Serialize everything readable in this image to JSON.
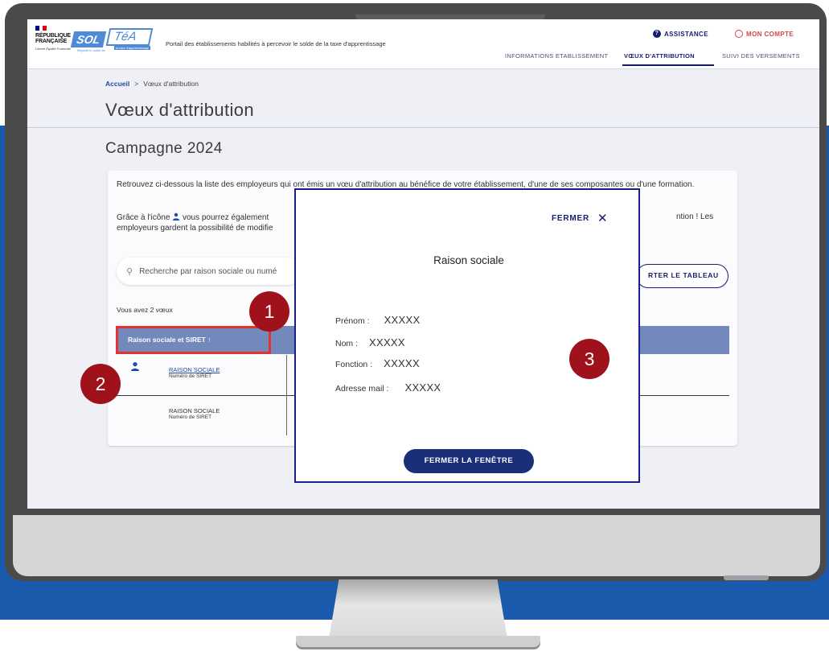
{
  "header": {
    "gov_name": "RÉPUBLIQUE FRANÇAISE",
    "gov_motto": "Liberté Égalité Fraternité",
    "logo_sol": "SOL",
    "logo_tea": "TéA",
    "logo_sol_sub": "Répartir le solde de",
    "logo_tea_sub": "la taxe d'apprentissage",
    "portal_text": "Portail des établissements habilités à percevoir le solde de la taxe d'apprentissage",
    "assistance_label": "ASSISTANCE",
    "account_label": "MON COMPTE",
    "nav": [
      "INFORMATIONS ETABLISSEMENT",
      "VŒUX D'ATTRIBUTION",
      "SUIVI DES VERSEMENTS"
    ]
  },
  "breadcrumb": {
    "home": "Accueil",
    "separator": ">",
    "current": "Vœux d'attribution"
  },
  "page_title": "Vœux d'attribution",
  "campaign_title": "Campagne 2024",
  "card": {
    "intro_1": "Retrouvez ci-dessous la liste des employeurs qui ont émis un vœu d'attribution au bénéfice de votre établissement, d'une de ses composantes ou d'une formation.",
    "intro_2_start": "Grâce à l'icône",
    "intro_2_rest": "vous pourrez également",
    "intro_2_line2": "employeurs gardent la possibilité de modifie",
    "intro_2_end": "ntion ! Les",
    "search_placeholder": "Recherche par raison sociale ou numé",
    "export_label": "RTER LE TABLEAU",
    "count_text": "Vous avez 2 vœux",
    "column_header": "Raison sociale et SIRET ↑",
    "rows": [
      {
        "name": "RAISON SOCIALE",
        "siret": "Numéro de SIRET"
      },
      {
        "name": "RAISON SOCIALE",
        "siret": "Numéro de SIRET"
      }
    ]
  },
  "modal": {
    "close_label": "FERMER",
    "close_icon": "✕",
    "title": "Raison sociale",
    "fields": [
      {
        "label": "Prénom :",
        "value": "XXXXX"
      },
      {
        "label": "Nom :",
        "value": "XXXXX"
      },
      {
        "label": "Fonction :",
        "value": "XXXXX"
      },
      {
        "label": "Adresse mail :",
        "value": "XXXXX"
      }
    ],
    "close_button": "FERMER LA FENÊTRE"
  },
  "callouts": [
    "1",
    "2",
    "3"
  ],
  "colors": {
    "brand_navy": "#161c6e",
    "table_header": "#7388bb",
    "highlight_red": "#e0332f",
    "callout_red": "#a0121b",
    "background_blue": "#1a5aad",
    "account_red": "#d64545"
  },
  "icons": {
    "assistance": "question-circle-icon",
    "account": "user-circle-icon",
    "search": "search-icon",
    "person": "person-icon",
    "close": "close-icon"
  }
}
